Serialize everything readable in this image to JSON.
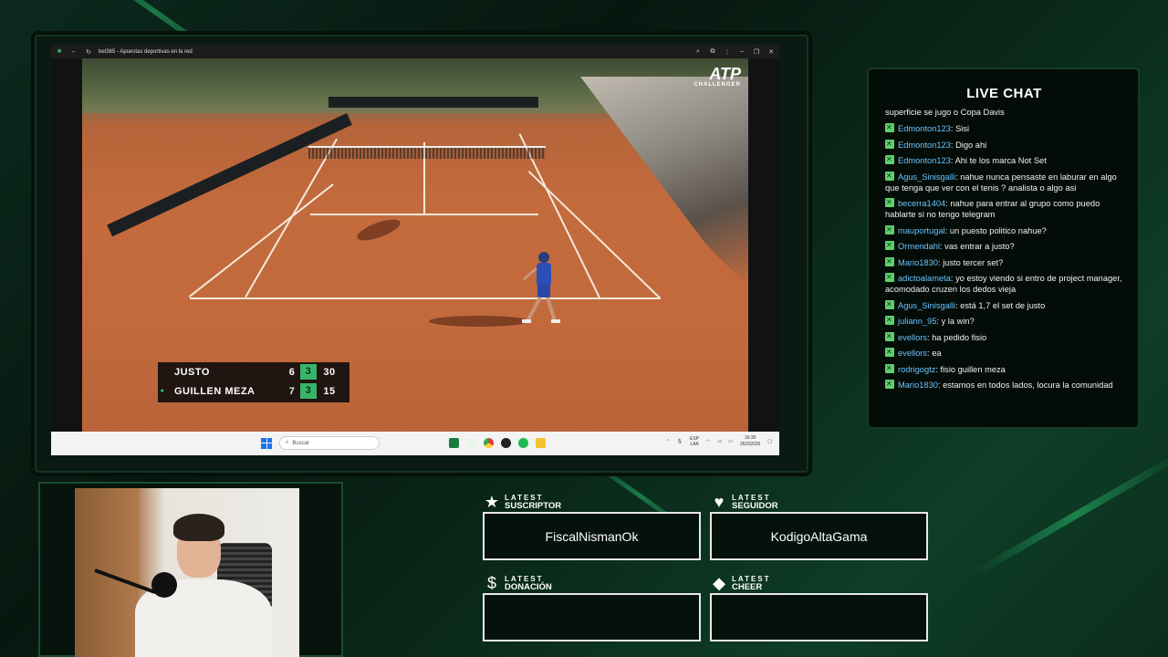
{
  "browser": {
    "tab_title": "bet365 - Apuestas deportivas en la red"
  },
  "broadcast": {
    "logo_main": "ATP",
    "logo_sub": "CHALLENGER"
  },
  "scoreboard": {
    "players": [
      {
        "name": "JUSTO",
        "sets": "6",
        "current_set": "3",
        "points": "30",
        "serving": false
      },
      {
        "name": "GUILLEN MEZA",
        "sets": "7",
        "current_set": "3",
        "points": "15",
        "serving": true
      }
    ]
  },
  "taskbar": {
    "search_placeholder": "Buscar",
    "lang": "ESP",
    "lang_sub": "LAA",
    "time": "16:30",
    "date": "26/2/2026"
  },
  "chat": {
    "title": "LIVE CHAT",
    "partial_first": "superficie se jugo o Copa Davis",
    "messages": [
      {
        "user": "Edmonton123",
        "text": "Sisi"
      },
      {
        "user": "Edmonton123",
        "text": "Digo ahi"
      },
      {
        "user": "Edmonton123",
        "text": "Ahi te los marca Not Set"
      },
      {
        "user": "Agus_Sinisgalli",
        "text": "nahue nunca pensaste en laburar en algo que tenga que ver con el tenis ? analista o algo asi"
      },
      {
        "user": "becerra1404",
        "text": "nahue para entrar al grupo como puedo hablarte si no tengo telegram"
      },
      {
        "user": "mauportugal",
        "text": "un puesto politico nahue?"
      },
      {
        "user": "Ormendahl",
        "text": "vas entrar a justo?"
      },
      {
        "user": "Mario1830",
        "text": "justo tercer set?"
      },
      {
        "user": "adictoalameta",
        "text": "yo estoy viendo si entro de project manager, acomodado cruzen los dedos vieja"
      },
      {
        "user": "Agus_Sinisgalli",
        "text": "está 1,7 el set de justo"
      },
      {
        "user": "juliann_95",
        "text": "y la win?"
      },
      {
        "user": "evellors",
        "text": "ha pedido fisio"
      },
      {
        "user": "evellors",
        "text": "ea"
      },
      {
        "user": "rodrigogtz",
        "text": "fisio guillen meza"
      },
      {
        "user": "Mario1830",
        "text": "estamos en todos lados, locura la comunidad"
      }
    ]
  },
  "latest": {
    "suscriptor": {
      "l1": "LATEST",
      "l2": "SUSCRIPTOR",
      "value": "FiscalNismanOk",
      "icon": "star-icon"
    },
    "seguidor": {
      "l1": "LATEST",
      "l2": "SEGUIDOR",
      "value": "KodigoAltaGama",
      "icon": "heart-icon"
    },
    "donacion": {
      "l1": "LATEST",
      "l2": "DONACIÓN",
      "value": "",
      "icon": "dollar-icon"
    },
    "cheer": {
      "l1": "LATEST",
      "l2": "CHEER",
      "value": "",
      "icon": "diamond-icon"
    }
  },
  "colors": {
    "accent_green": "#38b56a",
    "chat_user": "#69c4ff",
    "badge": "#5fcf6b"
  }
}
